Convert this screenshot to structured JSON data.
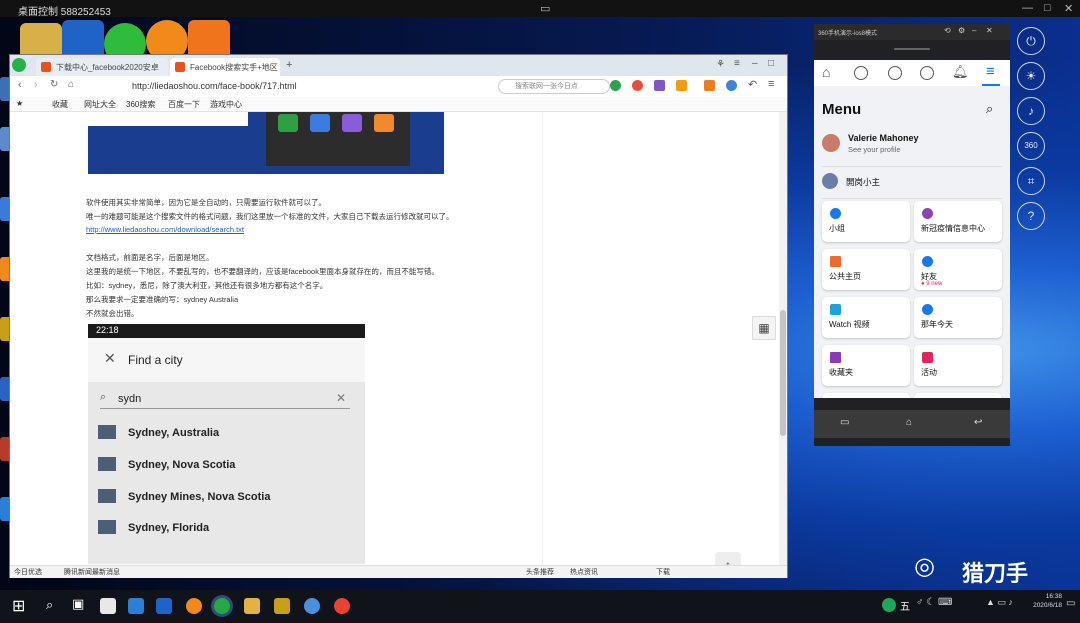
{
  "remote_title": "桌面控制 588252453",
  "browser": {
    "tabs": [
      {
        "label": "下载中心_facebook2020安卓"
      },
      {
        "label": "Facebook搜索实手+地区 前..."
      }
    ],
    "url": "http://liedaoshou.com/face-book/717.html",
    "search_placeholder": "搜索联网一张今日点",
    "bookmarks": [
      "收藏",
      "网址大全",
      "360搜索",
      "百度一下",
      "游戏中心"
    ],
    "article": {
      "paragraphs": [
        "软件使用其实非常简单，因为它是全自动的，只需要运行软件就可以了。",
        "唯一的难题可能是这个搜索文件的格式问题，我们这里放一个标准的文件，大家自己下载去运行修改就可以了。",
        "http://www.liedaoshou.com/download/search.txt",
        "文档格式，前面是名字，后面是地区。",
        "这里我的是统一下地区，不要乱写的，也不要翻译的，应该是facebook里面本身就存在的，而且不能写错。",
        "比如：sydney，悉尼，除了澳大利亚，其他还有很多地方都有这个名字。",
        "那么我要求一定要准确的写：sydney Australia",
        "不然就会出错。"
      ],
      "phone_shot": {
        "time": "22:18",
        "header": "Find a city",
        "query": "sydn",
        "results": [
          "Sydney, Australia",
          "Sydney, Nova Scotia",
          "Sydney Mines, Nova Scotia",
          "Sydney, Florida"
        ]
      }
    },
    "status_left": "今日优选",
    "status_news": "腾讯新闻最新消息",
    "status_right": [
      "头条推荐",
      "热点资讯",
      "下载"
    ]
  },
  "emulator": {
    "title": "360手机演示-ios8模式",
    "menu_title": "Menu",
    "profile_name": "Valerie Mahoney",
    "profile_sub": "See your profile",
    "page_name": "開岗小主",
    "tiles": [
      {
        "label": "小组",
        "sub": "",
        "icon_color": "#1877f2"
      },
      {
        "label": "新冠疫情信息中心",
        "sub": "",
        "icon_color": "#8e44ad"
      },
      {
        "label": "公共主页",
        "sub": "",
        "icon_color": "#f06a2d"
      },
      {
        "label": "好友",
        "sub": "● 9 new",
        "icon_color": "#1877f2"
      },
      {
        "label": "Watch 视频",
        "sub": "",
        "icon_color": "#1ca3d9"
      },
      {
        "label": "那年今天",
        "sub": "",
        "icon_color": "#1877f2"
      },
      {
        "label": "收藏夹",
        "sub": "",
        "icon_color": "#8a3ab9"
      },
      {
        "label": "活动",
        "sub": "",
        "icon_color": "#e0245e"
      }
    ]
  },
  "side_controls": [
    "power",
    "brightness",
    "volume",
    "360",
    "crop",
    "help"
  ],
  "taskbar": {
    "input_method": "五",
    "time": "16:38",
    "date": "2020/6/18"
  },
  "watermark": "猎刀手"
}
